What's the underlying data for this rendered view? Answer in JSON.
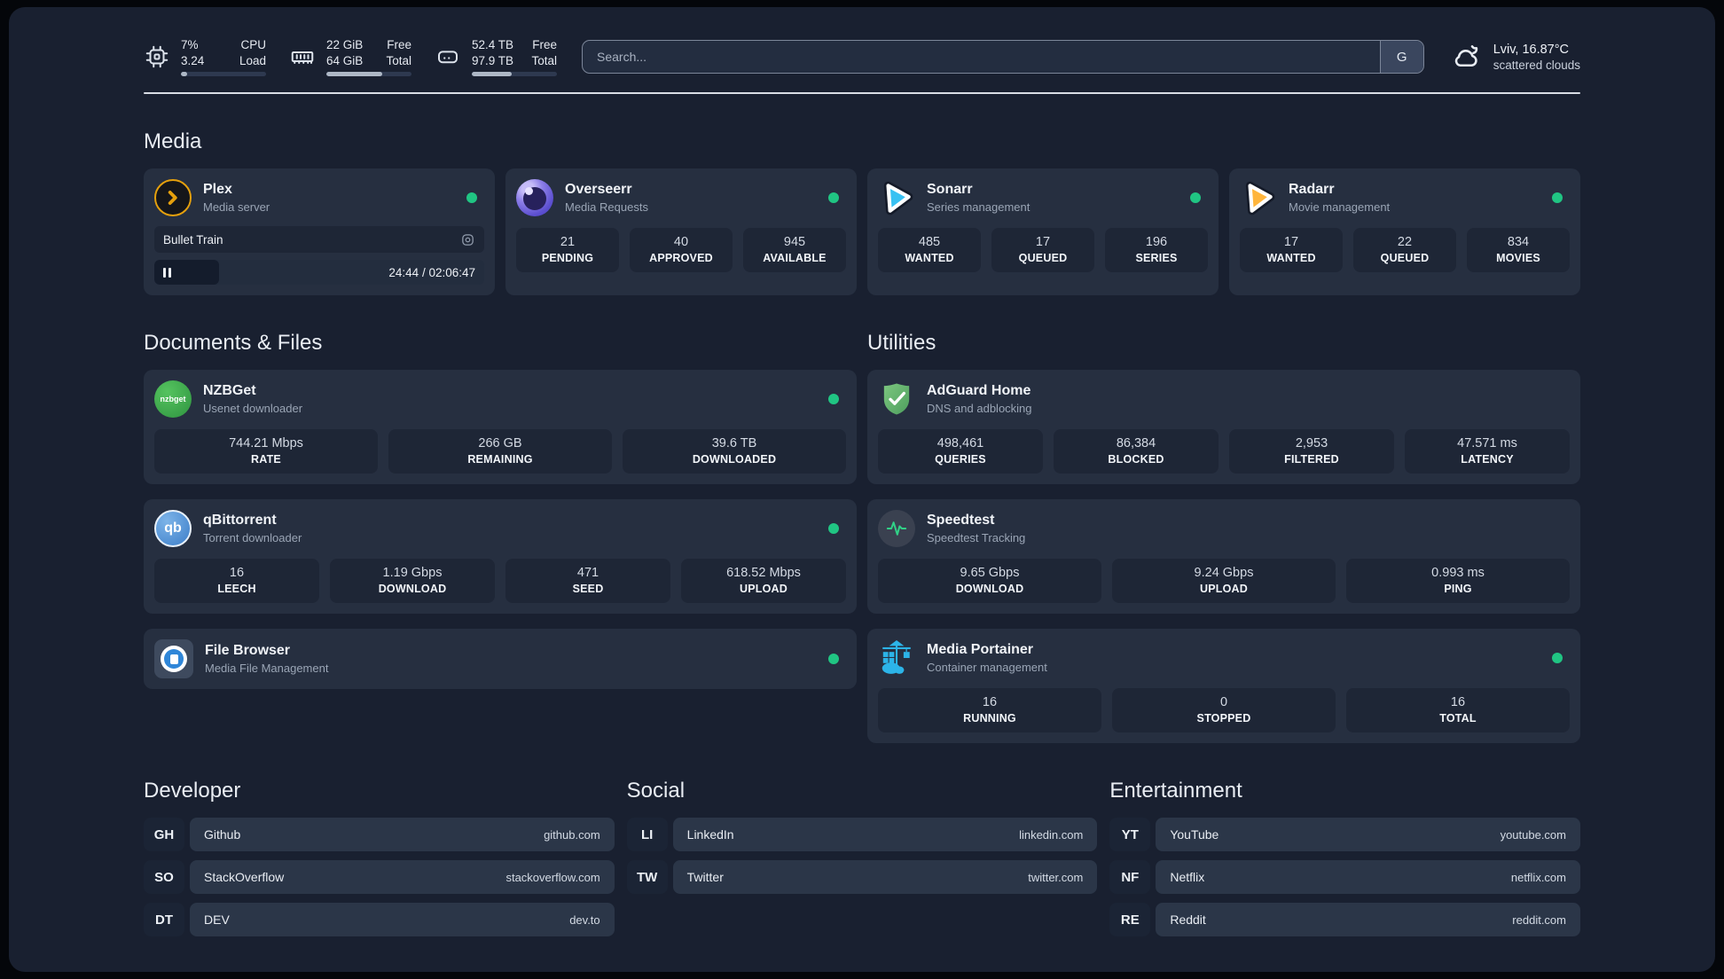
{
  "colors": {
    "page_background": "#192030",
    "card_background": "#262f40",
    "tile_background": "#1e2636",
    "status_online": "#20c583",
    "plex_accent": "#e5a00d",
    "sonarr_accent": "#38c1f2",
    "radarr_accent": "#ffb53c",
    "portainer_accent": "#2cb4e8",
    "adguard_accent": "#5fb26b",
    "speedtest_pulse": "#31d187"
  },
  "icons": {
    "cpu": "chip-outline",
    "ram": "memory-module-outline",
    "disk": "drive-outline",
    "search_engine": "letter-G",
    "weather": "cloud-moon-outline",
    "status": "green-dot",
    "pause": "double-bar",
    "session": "circle-in-rounded-square"
  },
  "topbar": {
    "cpu": {
      "value1": "7%",
      "value2": "3.24",
      "label1": "CPU",
      "label2": "Load",
      "progress_pct": 7
    },
    "ram": {
      "value1": "22 GiB",
      "value2": "64 GiB",
      "label1": "Free",
      "label2": "Total",
      "progress_pct": 66
    },
    "disk": {
      "value1": "52.4 TB",
      "value2": "97.9 TB",
      "label1": "Free",
      "label2": "Total",
      "progress_pct": 47
    },
    "search": {
      "placeholder": "Search...",
      "engine_button": "G"
    },
    "weather": {
      "location": "Lviv, 16.87°C",
      "condition": "scattered clouds"
    }
  },
  "media": {
    "title": "Media",
    "plex": {
      "name": "Plex",
      "description": "Media server",
      "now_playing": "Bullet Train",
      "time_display": "24:44 / 02:06:47",
      "progress_pct": 19.5,
      "status": "online"
    },
    "overseerr": {
      "name": "Overseerr",
      "description": "Media Requests",
      "status": "online",
      "stats": [
        {
          "value": "21",
          "label": "PENDING"
        },
        {
          "value": "40",
          "label": "APPROVED"
        },
        {
          "value": "945",
          "label": "AVAILABLE"
        }
      ]
    },
    "sonarr": {
      "name": "Sonarr",
      "description": "Series management",
      "status": "online",
      "stats": [
        {
          "value": "485",
          "label": "WANTED"
        },
        {
          "value": "17",
          "label": "QUEUED"
        },
        {
          "value": "196",
          "label": "SERIES"
        }
      ]
    },
    "radarr": {
      "name": "Radarr",
      "description": "Movie management",
      "status": "online",
      "stats": [
        {
          "value": "17",
          "label": "WANTED"
        },
        {
          "value": "22",
          "label": "QUEUED"
        },
        {
          "value": "834",
          "label": "MOVIES"
        }
      ]
    }
  },
  "documents": {
    "title": "Documents & Files",
    "nzbget": {
      "name": "NZBGet",
      "description": "Usenet downloader",
      "status": "online",
      "logo_text": "nzbget",
      "stats": [
        {
          "value": "744.21 Mbps",
          "label": "RATE"
        },
        {
          "value": "266 GB",
          "label": "REMAINING"
        },
        {
          "value": "39.6 TB",
          "label": "DOWNLOADED"
        }
      ]
    },
    "qbittorrent": {
      "name": "qBittorrent",
      "description": "Torrent downloader",
      "status": "online",
      "logo_text": "qb",
      "stats": [
        {
          "value": "16",
          "label": "LEECH"
        },
        {
          "value": "1.19 Gbps",
          "label": "DOWNLOAD"
        },
        {
          "value": "471",
          "label": "SEED"
        },
        {
          "value": "618.52 Mbps",
          "label": "UPLOAD"
        }
      ]
    },
    "filebrowser": {
      "name": "File Browser",
      "description": "Media File Management",
      "status": "online"
    }
  },
  "utilities": {
    "title": "Utilities",
    "adguard": {
      "name": "AdGuard Home",
      "description": "DNS and adblocking",
      "stats": [
        {
          "value": "498,461",
          "label": "QUERIES"
        },
        {
          "value": "86,384",
          "label": "BLOCKED"
        },
        {
          "value": "2,953",
          "label": "FILTERED"
        },
        {
          "value": "47.571 ms",
          "label": "LATENCY"
        }
      ]
    },
    "speedtest": {
      "name": "Speedtest",
      "description": "Speedtest Tracking",
      "stats": [
        {
          "value": "9.65 Gbps",
          "label": "DOWNLOAD"
        },
        {
          "value": "9.24 Gbps",
          "label": "UPLOAD"
        },
        {
          "value": "0.993 ms",
          "label": "PING"
        }
      ]
    },
    "portainer": {
      "name": "Media Portainer",
      "description": "Container management",
      "status": "online",
      "stats": [
        {
          "value": "16",
          "label": "RUNNING"
        },
        {
          "value": "0",
          "label": "STOPPED"
        },
        {
          "value": "16",
          "label": "TOTAL"
        }
      ]
    }
  },
  "bookmarks": {
    "developer": {
      "title": "Developer",
      "links": [
        {
          "abbr": "GH",
          "name": "Github",
          "url": "github.com"
        },
        {
          "abbr": "SO",
          "name": "StackOverflow",
          "url": "stackoverflow.com"
        },
        {
          "abbr": "DT",
          "name": "DEV",
          "url": "dev.to"
        }
      ]
    },
    "social": {
      "title": "Social",
      "links": [
        {
          "abbr": "LI",
          "name": "LinkedIn",
          "url": "linkedin.com"
        },
        {
          "abbr": "TW",
          "name": "Twitter",
          "url": "twitter.com"
        }
      ]
    },
    "entertainment": {
      "title": "Entertainment",
      "links": [
        {
          "abbr": "YT",
          "name": "YouTube",
          "url": "youtube.com"
        },
        {
          "abbr": "NF",
          "name": "Netflix",
          "url": "netflix.com"
        },
        {
          "abbr": "RE",
          "name": "Reddit",
          "url": "reddit.com"
        }
      ]
    }
  }
}
